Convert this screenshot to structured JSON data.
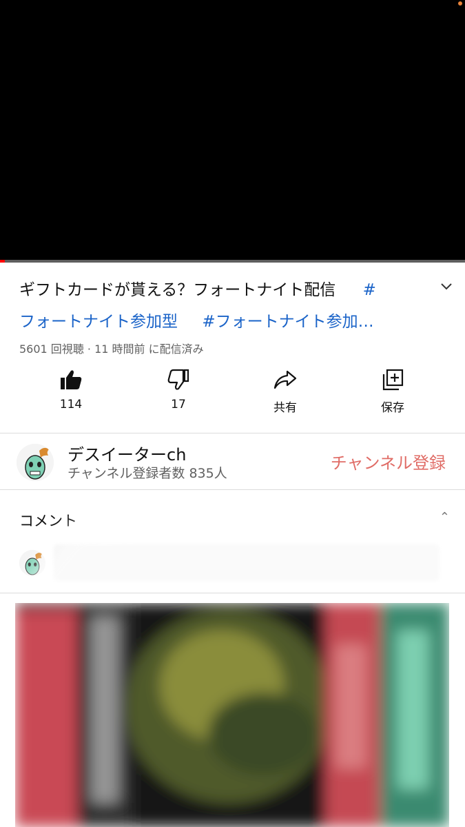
{
  "video": {
    "progress_percent": 1
  },
  "title": {
    "text": "ギフトカードが貰える？フォートナイト配信",
    "hashtag_1_line1": "#",
    "hashtag_1_line2": "フォートナイト参加型",
    "hashtag_2": "#フォートナイト参加…"
  },
  "meta": {
    "views_and_time": "5601 回視聴 · 11 時間前 に配信済み"
  },
  "actions": {
    "like_count": "114",
    "dislike_count": "17",
    "share_label": "共有",
    "save_label": "保存"
  },
  "channel": {
    "name": "デスイーターch",
    "subscribers": "チャンネル登録者数 835人",
    "subscribe_label": "チャンネル登録"
  },
  "comments": {
    "header": "コメント",
    "caret": "⌃"
  },
  "icons": {
    "like": "thumbs-up-icon",
    "dislike": "thumbs-down-icon",
    "share": "share-arrow-icon",
    "save": "add-to-playlist-icon",
    "expand": "chevron-down-icon"
  },
  "colors": {
    "hashtag": "#1a63c8",
    "subscribe": "#e06c66",
    "progress": "#ff0000"
  }
}
